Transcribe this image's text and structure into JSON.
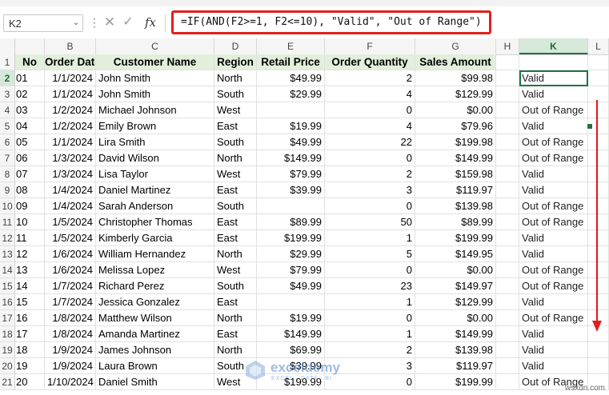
{
  "name_box": {
    "value": "K2"
  },
  "formula_bar": {
    "formula": "=IF(AND(F2>=1, F2<=10), \"Valid\", \"Out of Range\")",
    "cancel_glyph": "✕",
    "enter_glyph": "✓",
    "fx_label": "fx"
  },
  "columns": [
    "B",
    "C",
    "D",
    "E",
    "F",
    "G",
    "H",
    "K",
    "L"
  ],
  "headers": {
    "a": "No",
    "b": "Order Date",
    "c": "Customer Name",
    "d": "Region",
    "e": "Retail Price",
    "f": "Order Quantity",
    "g": "Sales Amount"
  },
  "rows": [
    {
      "num": "2",
      "a": "01",
      "b": "1/1/2024",
      "c": "John Smith",
      "d": "North",
      "e": "$49.99",
      "f": "2",
      "g": "$99.98",
      "k": "Valid"
    },
    {
      "num": "3",
      "a": "02",
      "b": "1/1/2024",
      "c": "John Smith",
      "d": "South",
      "e": "$29.99",
      "f": "4",
      "g": "$129.99",
      "k": "Valid"
    },
    {
      "num": "4",
      "a": "03",
      "b": "1/2/2024",
      "c": "Michael Johnson",
      "d": "West",
      "e": "",
      "f": "0",
      "g": "$0.00",
      "k": "Out of Range"
    },
    {
      "num": "5",
      "a": "04",
      "b": "1/2/2024",
      "c": "Emily Brown",
      "d": "East",
      "e": "$19.99",
      "f": "4",
      "g": "$79.96",
      "k": "Valid"
    },
    {
      "num": "6",
      "a": "05",
      "b": "1/1/2024",
      "c": "Lira Smith",
      "d": "South",
      "e": "$49.99",
      "f": "22",
      "g": "$199.98",
      "k": "Out of Range"
    },
    {
      "num": "7",
      "a": "06",
      "b": "1/3/2024",
      "c": "David Wilson",
      "d": "North",
      "e": "$149.99",
      "f": "0",
      "g": "$149.99",
      "k": "Out of Range"
    },
    {
      "num": "8",
      "a": "07",
      "b": "1/3/2024",
      "c": "Lisa Taylor",
      "d": "West",
      "e": "$79.99",
      "f": "2",
      "g": "$159.98",
      "k": "Valid"
    },
    {
      "num": "9",
      "a": "08",
      "b": "1/4/2024",
      "c": "Daniel Martinez",
      "d": "East",
      "e": "$39.99",
      "f": "3",
      "g": "$119.97",
      "k": "Valid"
    },
    {
      "num": "10",
      "a": "09",
      "b": "1/4/2024",
      "c": "Sarah Anderson",
      "d": "South",
      "e": "",
      "f": "0",
      "g": "$139.98",
      "k": "Out of Range"
    },
    {
      "num": "11",
      "a": "10",
      "b": "1/5/2024",
      "c": "Christopher Thomas",
      "d": "East",
      "e": "$89.99",
      "f": "50",
      "g": "$89.99",
      "k": "Out of Range"
    },
    {
      "num": "12",
      "a": "11",
      "b": "1/5/2024",
      "c": "Kimberly Garcia",
      "d": "East",
      "e": "$199.99",
      "f": "1",
      "g": "$199.99",
      "k": "Valid"
    },
    {
      "num": "13",
      "a": "12",
      "b": "1/6/2024",
      "c": "William Hernandez",
      "d": "North",
      "e": "$29.99",
      "f": "5",
      "g": "$149.95",
      "k": "Valid"
    },
    {
      "num": "14",
      "a": "13",
      "b": "1/6/2024",
      "c": "Melissa Lopez",
      "d": "West",
      "e": "$79.99",
      "f": "0",
      "g": "$0.00",
      "k": "Out of Range"
    },
    {
      "num": "15",
      "a": "14",
      "b": "1/7/2024",
      "c": "Richard Perez",
      "d": "South",
      "e": "$49.99",
      "f": "23",
      "g": "$149.97",
      "k": "Out of Range"
    },
    {
      "num": "16",
      "a": "15",
      "b": "1/7/2024",
      "c": "Jessica Gonzalez",
      "d": "East",
      "e": "",
      "f": "1",
      "g": "$129.99",
      "k": "Valid"
    },
    {
      "num": "17",
      "a": "16",
      "b": "1/8/2024",
      "c": "Matthew Wilson",
      "d": "North",
      "e": "$19.99",
      "f": "0",
      "g": "$0.00",
      "k": "Out of Range"
    },
    {
      "num": "18",
      "a": "17",
      "b": "1/8/2024",
      "c": "Amanda Martinez",
      "d": "East",
      "e": "$149.99",
      "f": "1",
      "g": "$149.99",
      "k": "Valid"
    },
    {
      "num": "19",
      "a": "18",
      "b": "1/9/2024",
      "c": "James Johnson",
      "d": "North",
      "e": "$69.99",
      "f": "2",
      "g": "$139.98",
      "k": "Valid"
    },
    {
      "num": "20",
      "a": "19",
      "b": "1/9/2024",
      "c": "Laura Brown",
      "d": "South",
      "e": "$39.99",
      "f": "3",
      "g": "$119.97",
      "k": "Valid"
    },
    {
      "num": "21",
      "a": "20",
      "b": "1/10/2024",
      "c": "Daniel Smith",
      "d": "West",
      "e": "$199.99",
      "f": "0",
      "g": "$199.99",
      "k": "Out of Range"
    }
  ],
  "watermark": {
    "name": "exceldemy",
    "tagline": "EXCEL · DATA · BI",
    "site": "wsxdn.com"
  },
  "colors": {
    "header_fill": "#e2efda",
    "selection": "#217346",
    "highlight_border": "#e0201c",
    "arrow": "#e0201c"
  }
}
